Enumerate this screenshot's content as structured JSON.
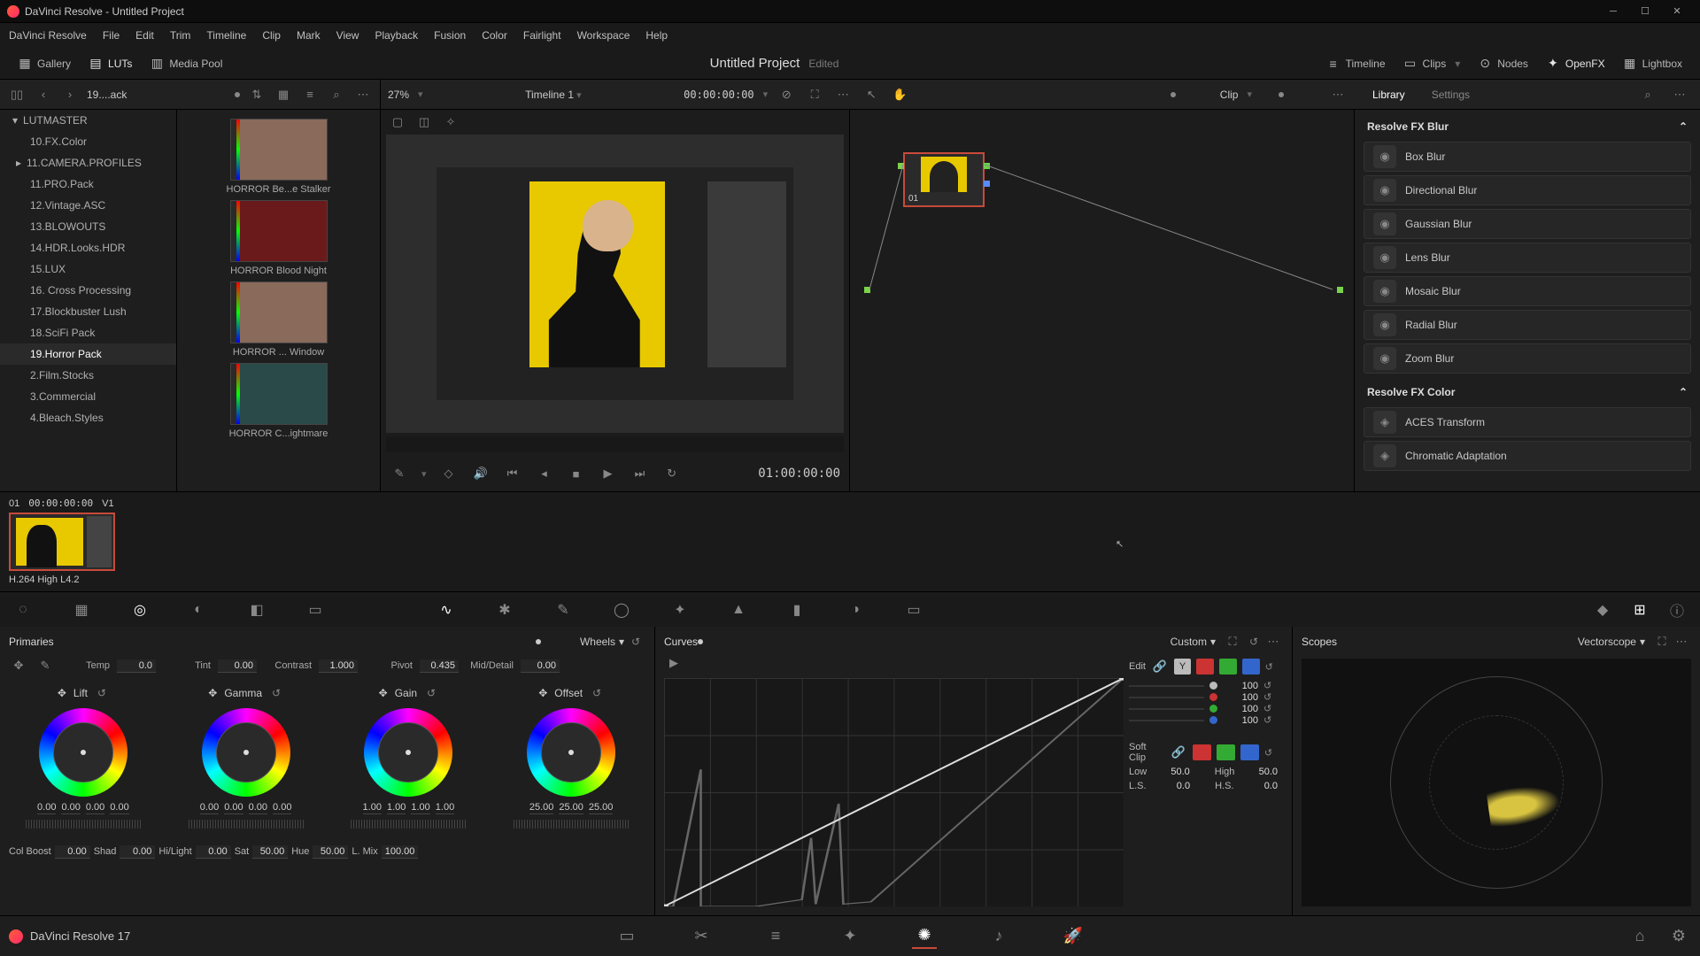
{
  "titlebar": {
    "app": "DaVinci Resolve",
    "project": "Untitled Project"
  },
  "menu": [
    "DaVinci Resolve",
    "File",
    "Edit",
    "Trim",
    "Timeline",
    "Clip",
    "Mark",
    "View",
    "Playback",
    "Fusion",
    "Color",
    "Fairlight",
    "Workspace",
    "Help"
  ],
  "topbar": {
    "gallery": "Gallery",
    "luts": "LUTs",
    "mediapool": "Media Pool",
    "project": "Untitled Project",
    "edited": "Edited",
    "timeline": "Timeline",
    "clips": "Clips",
    "nodes": "Nodes",
    "openfx": "OpenFX",
    "lightbox": "Lightbox"
  },
  "subbar": {
    "crumb": "19....ack",
    "zoom": "27%",
    "timeline": "Timeline 1",
    "timecode": "00:00:00:00",
    "clip": "Clip",
    "library": "Library",
    "settings": "Settings"
  },
  "lut_tree": [
    {
      "label": "LUTMASTER",
      "kind": "root"
    },
    {
      "label": "10.FX.Color"
    },
    {
      "label": "11.CAMERA.PROFILES",
      "expandable": true
    },
    {
      "label": "11.PRO.Pack"
    },
    {
      "label": "12.Vintage.ASC"
    },
    {
      "label": "13.BLOWOUTS"
    },
    {
      "label": "14.HDR.Looks.HDR"
    },
    {
      "label": "15.LUX"
    },
    {
      "label": "16. Cross Processing"
    },
    {
      "label": "17.Blockbuster Lush"
    },
    {
      "label": "18.SciFi Pack"
    },
    {
      "label": "19.Horror Pack",
      "sel": true
    },
    {
      "label": "2.Film.Stocks"
    },
    {
      "label": "3.Commercial"
    },
    {
      "label": "4.Bleach.Styles"
    }
  ],
  "luts": [
    {
      "label": "HORROR Be...e Stalker",
      "tone": "norm"
    },
    {
      "label": "HORROR Blood Night",
      "tone": "red"
    },
    {
      "label": "HORROR ... Window",
      "tone": "norm"
    },
    {
      "label": "HORROR C...ightmare",
      "tone": "teal"
    }
  ],
  "transport": {
    "tc": "01:00:00:00"
  },
  "node": {
    "label": "01"
  },
  "fx": {
    "blur_head": "Resolve FX Blur",
    "blur": [
      "Box Blur",
      "Directional Blur",
      "Gaussian Blur",
      "Lens Blur",
      "Mosaic Blur",
      "Radial Blur",
      "Zoom Blur"
    ],
    "color_head": "Resolve FX Color",
    "color": [
      "ACES Transform",
      "Chromatic Adaptation"
    ]
  },
  "clipstrip": {
    "num": "01",
    "tc": "00:00:00:00",
    "v": "V1",
    "codec": "H.264 High L4.2"
  },
  "primaries": {
    "title": "Primaries",
    "mode": "Wheels",
    "temp": {
      "lbl": "Temp",
      "val": "0.0"
    },
    "tint": {
      "lbl": "Tint",
      "val": "0.00"
    },
    "contrast": {
      "lbl": "Contrast",
      "val": "1.000"
    },
    "pivot": {
      "lbl": "Pivot",
      "val": "0.435"
    },
    "middetail": {
      "lbl": "Mid/Detail",
      "val": "0.00"
    },
    "wheels": [
      {
        "name": "Lift",
        "vals": [
          "0.00",
          "0.00",
          "0.00",
          "0.00"
        ]
      },
      {
        "name": "Gamma",
        "vals": [
          "0.00",
          "0.00",
          "0.00",
          "0.00"
        ]
      },
      {
        "name": "Gain",
        "vals": [
          "1.00",
          "1.00",
          "1.00",
          "1.00"
        ]
      },
      {
        "name": "Offset",
        "vals": [
          "25.00",
          "25.00",
          "25.00"
        ]
      }
    ],
    "bottom": [
      {
        "lbl": "Col Boost",
        "val": "0.00"
      },
      {
        "lbl": "Shad",
        "val": "0.00"
      },
      {
        "lbl": "Hi/Light",
        "val": "0.00"
      },
      {
        "lbl": "Sat",
        "val": "50.00"
      },
      {
        "lbl": "Hue",
        "val": "50.00"
      },
      {
        "lbl": "L. Mix",
        "val": "100.00"
      }
    ]
  },
  "curves": {
    "title": "Curves",
    "mode": "Custom",
    "edit": "Edit",
    "softclip": "Soft Clip",
    "channels": [
      "100",
      "100",
      "100",
      "100"
    ],
    "low": {
      "lbl": "Low",
      "val": "50.0"
    },
    "high": {
      "lbl": "High",
      "val": "50.0"
    },
    "ls": {
      "lbl": "L.S.",
      "val": "0.0"
    },
    "hs": {
      "lbl": "H.S.",
      "val": "0.0"
    }
  },
  "scopes": {
    "title": "Scopes",
    "mode": "Vectorscope"
  },
  "footer": {
    "brand": "DaVinci Resolve 17"
  }
}
